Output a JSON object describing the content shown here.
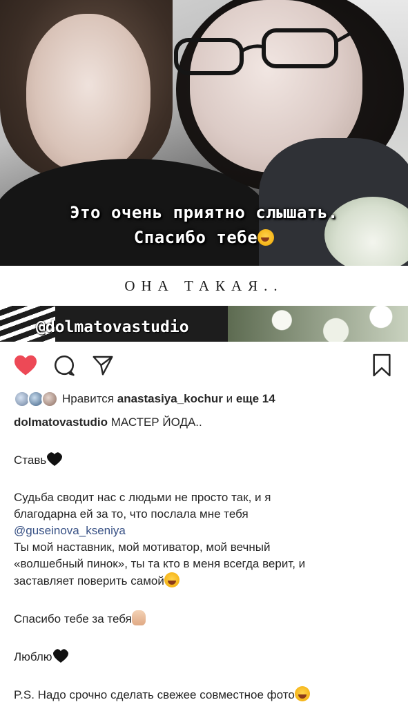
{
  "story": {
    "text_line1": "Это очень приятно слышать.",
    "text_line2": "Спасибо тебе",
    "band_text": "ОНА ТАКАЯ..",
    "mention_tag": "@dolmatovastudio"
  },
  "actions": {
    "like": "heart-icon",
    "comment": "comment-icon",
    "share": "send-icon",
    "save": "bookmark-icon",
    "like_color": "#ed4956"
  },
  "likes": {
    "prefix": "Нравится",
    "user": "anastasiya_kochur",
    "middle": "и",
    "others": "еще 14"
  },
  "caption": {
    "username": "dolmatovastudio",
    "line1_text": "МАСТЕР ЙОДА..",
    "line2": "Ставь",
    "para1_a": "Судьба сводит нас с людьми не просто так, и я",
    "para1_b": "благодарна ей за то, что послала мне тебя",
    "mention": "@guseinova_kseniya",
    "para2_a": "Ты мой наставник, мой мотиватор, мой вечный",
    "para2_b": "«волшебный пинок», ты та кто в меня всегда верит, и",
    "para2_c": "заставляет поверить самой",
    "thanks": "Спасибо тебе за тебя",
    "love": "Люблю",
    "ps": "P.S. Надо срочно сделать свежее совместное фото"
  }
}
